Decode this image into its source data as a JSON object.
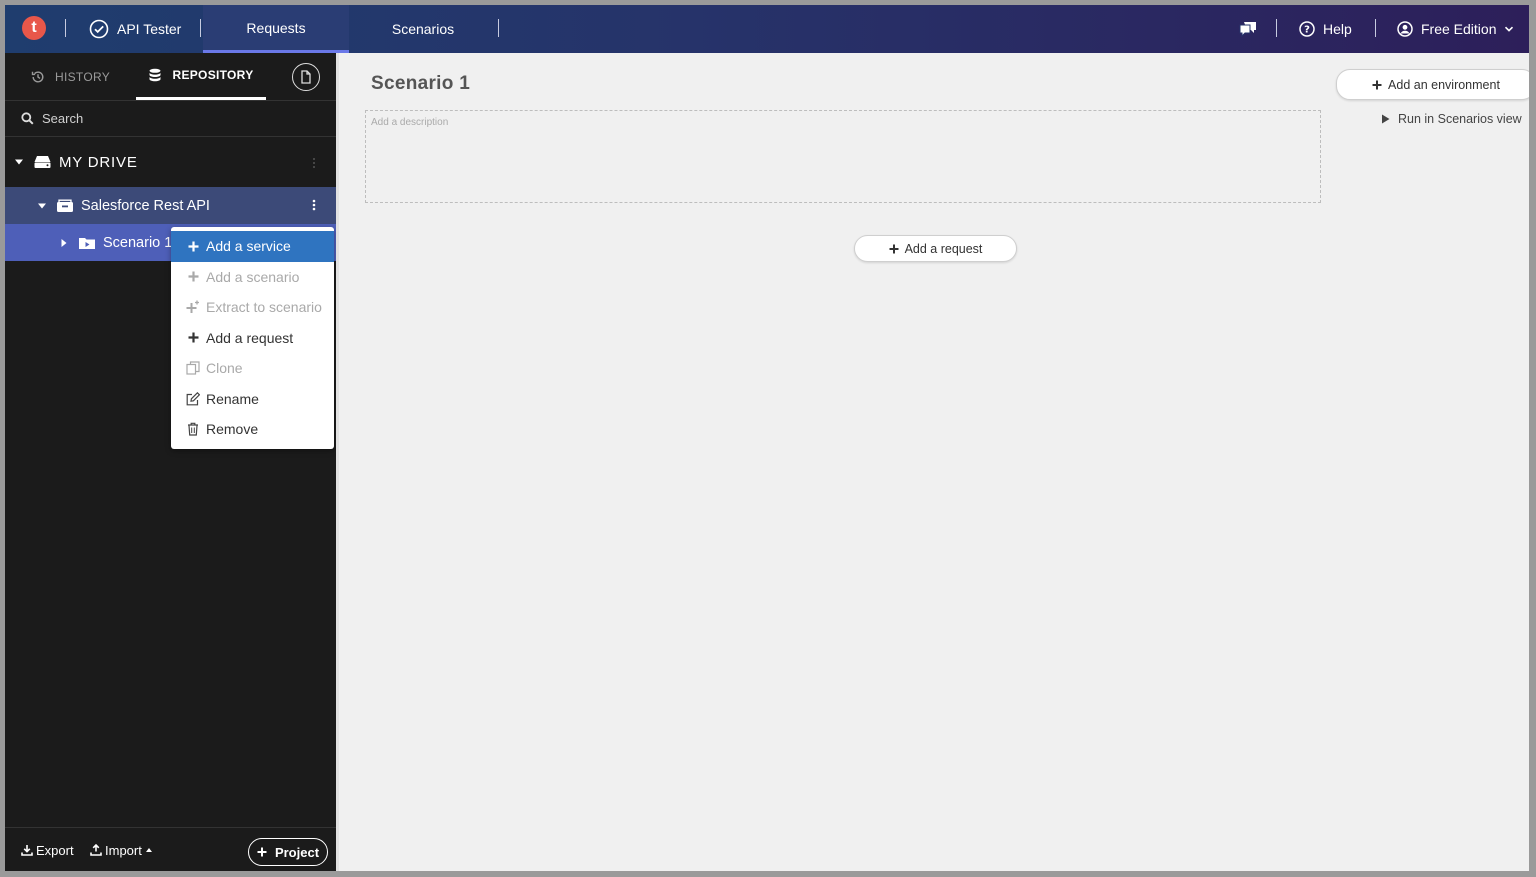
{
  "topbar": {
    "logo_letter": "t",
    "app_name": "API Tester",
    "tabs": [
      {
        "label": "Requests",
        "active": true
      },
      {
        "label": "Scenarios",
        "active": false
      }
    ],
    "help_label": "Help",
    "edition_label": "Free Edition"
  },
  "sidebar": {
    "tabs": {
      "history": "HISTORY",
      "repository": "REPOSITORY"
    },
    "search_placeholder": "Search",
    "drive_label": "MY DRIVE",
    "tree": {
      "service": "Salesforce Rest API",
      "scenario": "Scenario 1"
    },
    "footer": {
      "export_label": "Export",
      "import_label": "Import",
      "project_label": "Project"
    }
  },
  "context_menu": {
    "items": [
      {
        "label": "Add a service",
        "icon": "plus-icon",
        "state": "highlighted"
      },
      {
        "label": "Add a scenario",
        "icon": "plus-icon",
        "state": "disabled"
      },
      {
        "label": "Extract to scenario",
        "icon": "sparkle-plus-icon",
        "state": "disabled"
      },
      {
        "label": "Add a request",
        "icon": "plus-icon",
        "state": "enabled"
      },
      {
        "label": "Clone",
        "icon": "clone-icon",
        "state": "disabled"
      },
      {
        "label": "Rename",
        "icon": "edit-icon",
        "state": "enabled"
      },
      {
        "label": "Remove",
        "icon": "trash-icon",
        "state": "enabled"
      }
    ]
  },
  "main": {
    "title": "Scenario 1",
    "description_placeholder": "Add a description",
    "add_environment_label": "Add an environment",
    "run_label": "Run in Scenarios view",
    "add_request_label": "Add a request"
  },
  "colors": {
    "topbar_start": "#1f3d6e",
    "topbar_end": "#2d1f5a",
    "sidebar_bg": "#1b1b1b",
    "service_row": "#3c4a78",
    "scenario_row": "#4e5fb8",
    "menu_highlight": "#2f74c0",
    "logo": "#e8574a"
  }
}
